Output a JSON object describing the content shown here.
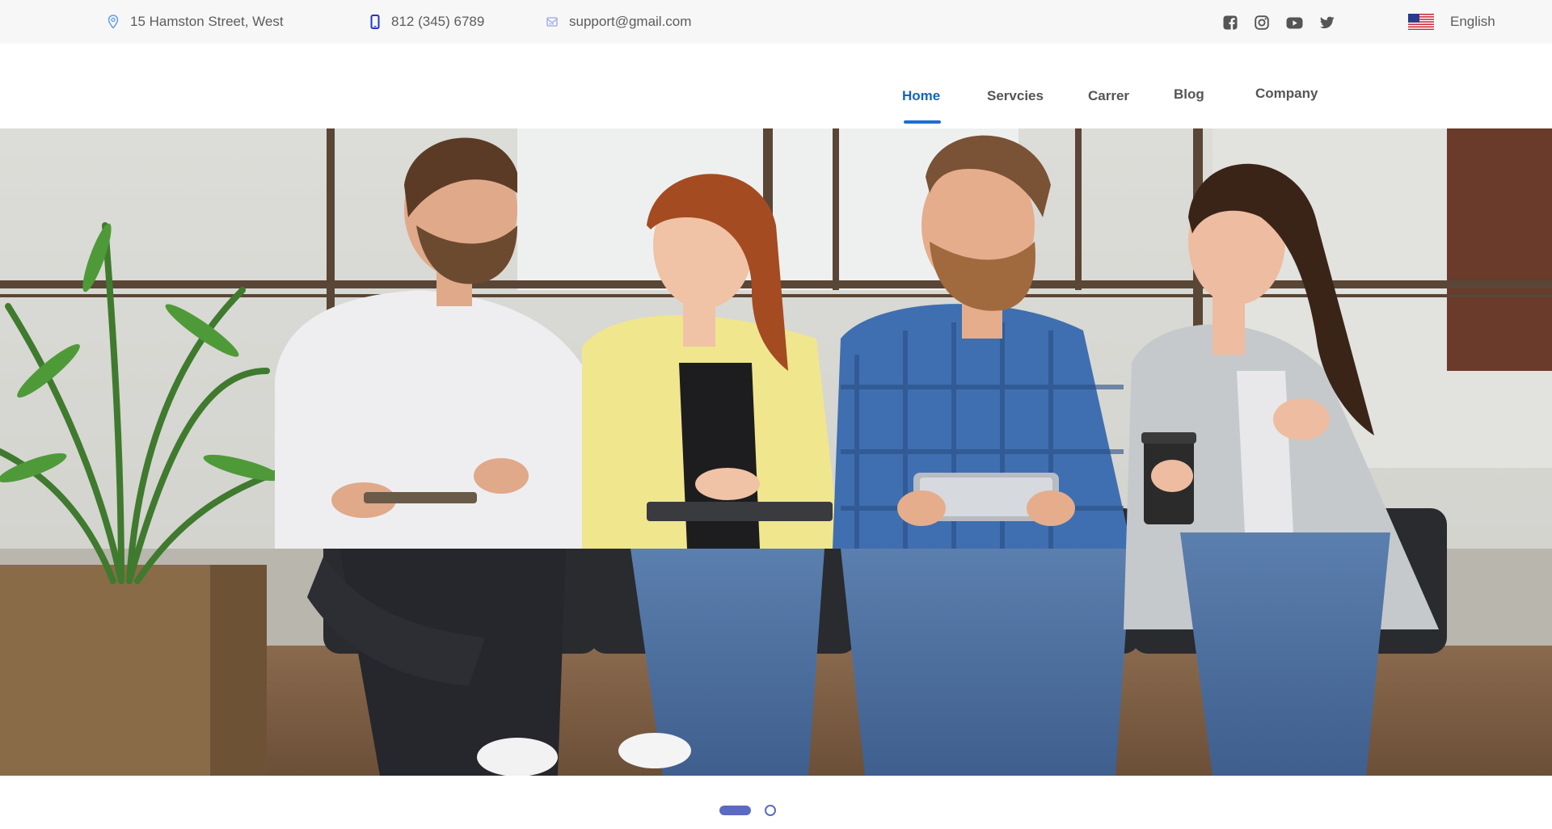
{
  "topbar": {
    "address": "15 Hamston Street, West",
    "phone": "812 (345) 6789",
    "email": "support@gmail.com",
    "social_icons": [
      "facebook-icon",
      "instagram-icon",
      "youtube-icon",
      "twitter-icon"
    ],
    "language": "English",
    "colors": {
      "background": "#f7f7f7",
      "text": "#5c5c5c",
      "icon": "#555555",
      "accent": "#3f51b5"
    }
  },
  "nav": {
    "items": [
      {
        "label": "Home",
        "active": true
      },
      {
        "label": "Servcies",
        "active": false
      },
      {
        "label": "Carrer",
        "active": false
      },
      {
        "label": "Blog",
        "active": false
      },
      {
        "label": "Company",
        "active": false
      }
    ],
    "colors": {
      "active": "#1565c0",
      "inactive": "#555555"
    }
  },
  "hero": {
    "image": "group of four colleagues sitting on chairs in an office, talking"
  },
  "carousel": {
    "slides": 2,
    "active_index": 0,
    "color": "#5c6bc0"
  }
}
